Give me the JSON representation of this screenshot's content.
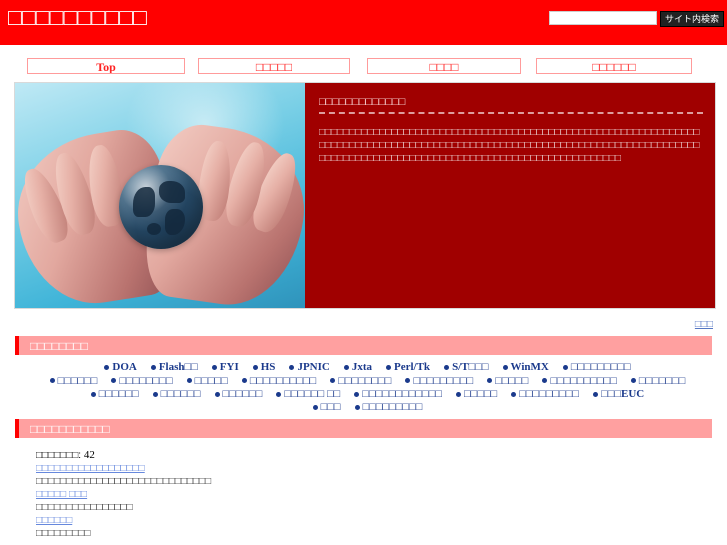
{
  "header": {
    "site_title": "□□□□□□□□□□",
    "brand_color": "#ff0000",
    "search": {
      "value": "",
      "placeholder": "",
      "button_label": "サイト内検索"
    }
  },
  "nav": {
    "items": [
      {
        "label": "Top"
      },
      {
        "label": "□□□□□"
      },
      {
        "label": "□□□□"
      },
      {
        "label": "□□□□□□"
      }
    ]
  },
  "hero": {
    "photo_alt": "hands-holding-glass-globe",
    "panel_bg": "#a00000",
    "panel_title": "□□□□□□□□□□□□□",
    "panel_body": "□□□□□□□□□□□□□□□□□□□□□□□□□□□□□□□□□□□□□□□□□□□□□□□□□□□□□□□□□□□□□□□□□□□□□□□□□□□□□□□□□□□□□□□□□□□□□□□□□□□□□□□□□□□□□□□□□□□□□□□□□□□□□□□□□□□□□□□□□□□□□□□□□□□□□□□□□□□□□□□□□□□□□□□□□□□□□□□□"
  },
  "more": {
    "label": "□□□"
  },
  "sections": {
    "keywords": {
      "title": "□□□□□□□□",
      "rows": [
        [
          "DOA",
          "Flash□□",
          "FYI",
          "HS",
          "JPNIC",
          "Jxta",
          "Perl/Tk",
          "S/T□□□",
          "WinMX",
          "□□□□□□□□□"
        ],
        [
          "□□□□□□",
          "□□□□□□□□",
          "□□□□□",
          "□□□□□□□□□□",
          "□□□□□□□□",
          "□□□□□□□□□",
          "□□□□□",
          "□□□□□□□□□□",
          "□□□□□□□"
        ],
        [
          "□□□□□□",
          "□□□□□□",
          "□□□□□□",
          "□□□□□□ □□",
          "□□□□□□□□□□□□",
          "□□□□□",
          "□□□□□□□□□",
          "□□□EUC"
        ],
        [
          "□□□",
          "□□□□□□□□□"
        ]
      ]
    },
    "news": {
      "title": "□□□□□□□□□□□",
      "count_label": "□□□□□□□:",
      "count_value": "42",
      "entries": [
        {
          "link": "□□□□□□□□□□□□□□□□□□",
          "desc": "□□□□□□□□□□□□□□□□□□□□□□□□□□□□□"
        },
        {
          "link": "□□□□□ □□□",
          "desc": "□□□□□□□□□□□□□□□□"
        },
        {
          "link": "□□□□□□",
          "desc": "□□□□□□□□□"
        }
      ]
    }
  }
}
